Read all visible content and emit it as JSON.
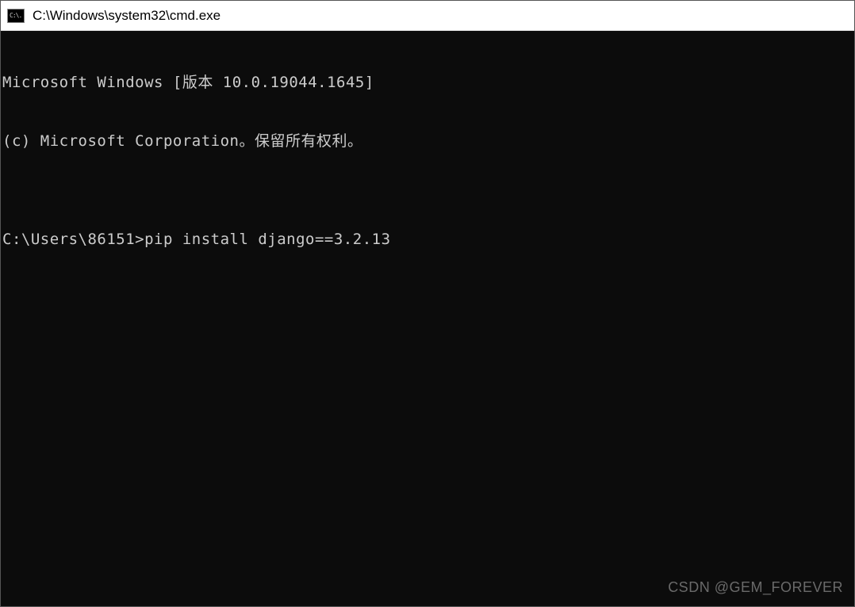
{
  "window": {
    "title": "C:\\Windows\\system32\\cmd.exe",
    "icon_label": "C:\\."
  },
  "terminal": {
    "line1": "Microsoft Windows [版本 10.0.19044.1645]",
    "line2": "(c) Microsoft Corporation。保留所有权利。",
    "blank": "",
    "prompt": "C:\\Users\\86151>",
    "command": "pip install django==3.2.13"
  },
  "watermark": "CSDN @GEM_FOREVER"
}
